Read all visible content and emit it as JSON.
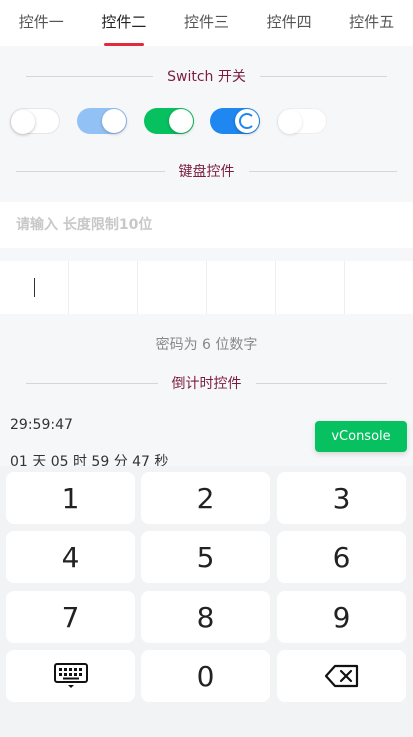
{
  "tabs": [
    "控件一",
    "控件二",
    "控件三",
    "控件四",
    "控件五"
  ],
  "active_tab_index": 1,
  "sections": {
    "switch_title": "Switch 开关",
    "keyboard_title": "键盘控件",
    "countdown_title": "倒计时控件"
  },
  "switches": [
    {
      "state": "off",
      "disabled": false
    },
    {
      "state": "on",
      "disabled": true
    },
    {
      "state": "on",
      "disabled": false,
      "color": "#07c160"
    },
    {
      "state": "on",
      "loading": true,
      "color": "#1f87f0"
    },
    {
      "state": "off",
      "disabled": true
    }
  ],
  "input": {
    "placeholder": "请输入 长度限制10位",
    "value": ""
  },
  "password": {
    "length": 6,
    "hint": "密码为 6 位数字"
  },
  "countdown": {
    "time": "29:59:47",
    "full": "01 天 05 时 59 分 47 秒"
  },
  "vconsole_label": "vConsole",
  "keyboard": {
    "keys": [
      "1",
      "2",
      "3",
      "4",
      "5",
      "6",
      "7",
      "8",
      "9",
      "",
      "0",
      ""
    ],
    "icons": {
      "collapse": "keyboard-icon",
      "delete": "backspace-icon"
    }
  },
  "colors": {
    "accent": "#e22b3d",
    "success": "#07c160",
    "primary": "#1f87f0",
    "section_title": "#7c1d3b"
  }
}
